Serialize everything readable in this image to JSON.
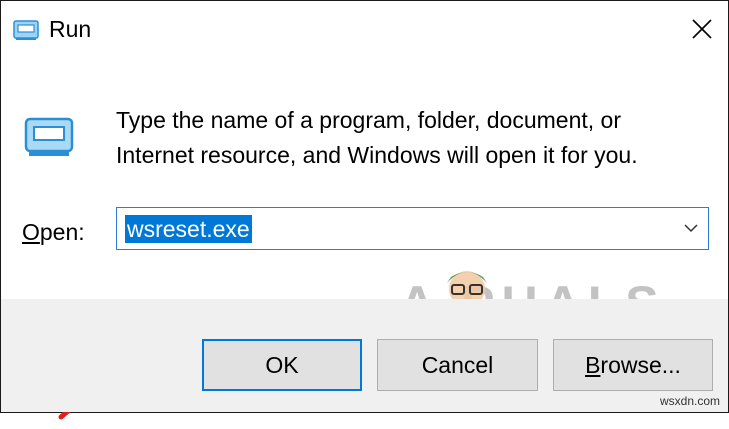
{
  "window": {
    "title": "Run",
    "close_label": "close"
  },
  "description": {
    "line1": "Type the name of a program, folder, document, or",
    "line2": "Internet resource, and Windows will open it for you."
  },
  "open_field": {
    "label_first": "O",
    "label_rest": "pen:",
    "value": "wsreset.exe"
  },
  "buttons": {
    "ok": "OK",
    "cancel": "Cancel",
    "browse_first": "B",
    "browse_rest": "rowse..."
  },
  "watermark": {
    "text": "A  PUALS",
    "site": "wsxdn.com"
  },
  "colors": {
    "accent": "#0078d7",
    "footer": "#f0f0f0",
    "annotation_arrow": "#e02020"
  },
  "icons": [
    "run-app-icon",
    "close-icon",
    "chevron-down-icon"
  ]
}
